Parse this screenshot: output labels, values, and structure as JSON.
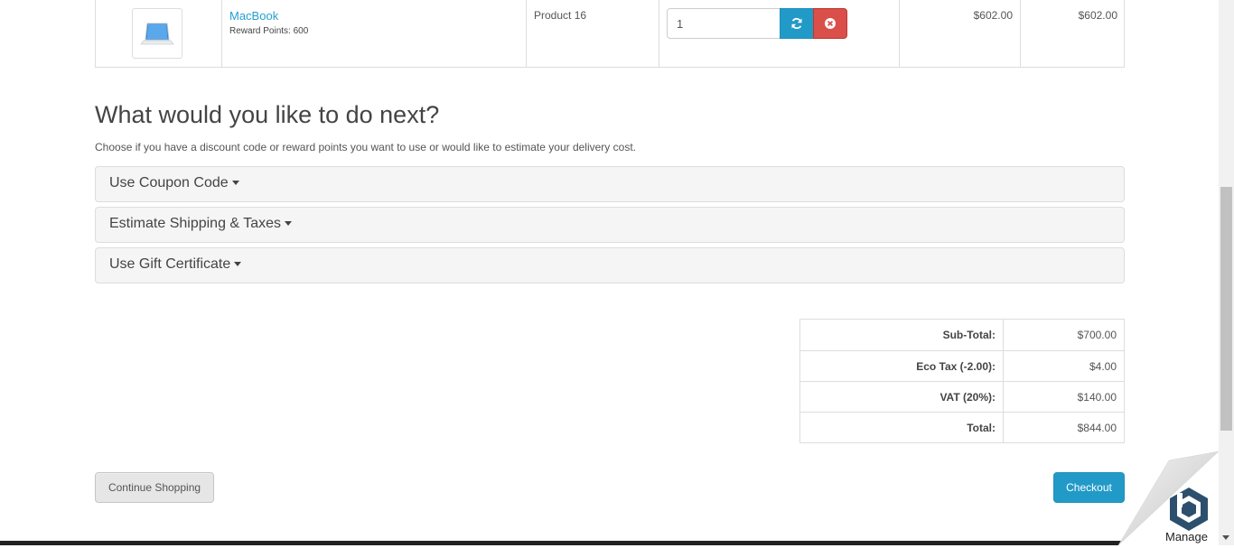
{
  "cart": {
    "product_name": "MacBook",
    "reward_points": "Reward Points: 600",
    "model": "Product 16",
    "quantity": "1",
    "unit_price": "$602.00",
    "total": "$602.00"
  },
  "next": {
    "heading": "What would you like to do next?",
    "intro": "Choose if you have a discount code or reward points you want to use or would like to estimate your delivery cost.",
    "panels": [
      {
        "label": "Use Coupon Code"
      },
      {
        "label": "Estimate Shipping & Taxes"
      },
      {
        "label": "Use Gift Certificate"
      }
    ]
  },
  "totals": [
    {
      "label": "Sub-Total:",
      "value": "$700.00"
    },
    {
      "label": "Eco Tax (-2.00):",
      "value": "$4.00"
    },
    {
      "label": "VAT (20%):",
      "value": "$140.00"
    },
    {
      "label": "Total:",
      "value": "$844.00"
    }
  ],
  "buttons": {
    "continue": "Continue Shopping",
    "checkout": "Checkout"
  },
  "widget": {
    "label": "Manage",
    "icon": "manage-hexagon-icon"
  },
  "colors": {
    "primary": "#229ac8",
    "danger": "#da4f49",
    "link": "#23a1d1"
  }
}
